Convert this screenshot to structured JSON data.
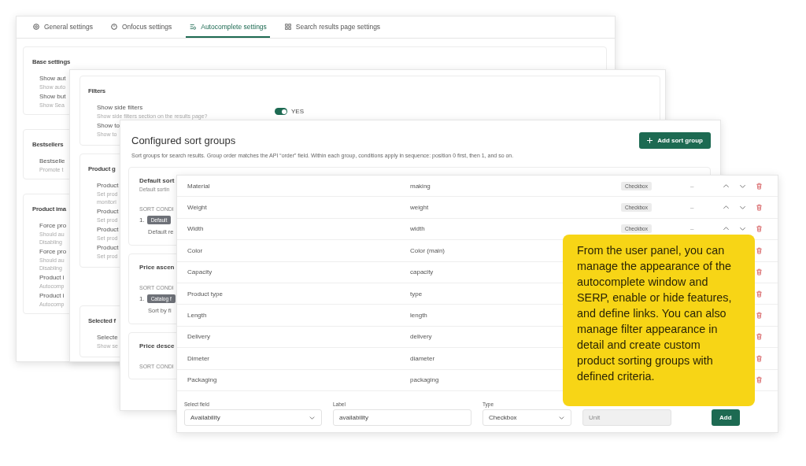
{
  "settings_window": {
    "tabs": [
      {
        "label": "General settings",
        "selected": false
      },
      {
        "label": "Onfocus settings",
        "selected": false
      },
      {
        "label": "Autocomplete settings",
        "selected": true
      },
      {
        "label": "Search results page settings",
        "selected": false
      }
    ],
    "cards": [
      {
        "title": "Base settings",
        "items": [
          {
            "label": "Show aut",
            "hints": [
              "Show auto"
            ]
          },
          {
            "label": "Show but",
            "hints": [
              "Show Sea"
            ]
          }
        ]
      },
      {
        "title": "Bestsellers",
        "items": [
          {
            "label": "Bestselle",
            "hints": [
              "Promote t"
            ]
          }
        ]
      },
      {
        "title": "Product ima",
        "items": [
          {
            "label": "Force pro",
            "hints": [
              "Should au",
              "Disabling"
            ]
          },
          {
            "label": "Force pro",
            "hints": [
              "Should au",
              "Disabling"
            ]
          },
          {
            "label": "Product i",
            "hints": [
              "Autocomp"
            ]
          },
          {
            "label": "Product i",
            "hints": [
              "Autocomp"
            ]
          }
        ]
      }
    ]
  },
  "filters_window": {
    "cards": [
      {
        "title": "Filters",
        "items": [
          {
            "label": "Show side filters",
            "hints": [
              "Show side filters section on the results page?"
            ],
            "toggle": {
              "on": true,
              "label": "YES"
            }
          },
          {
            "label": "Show to",
            "hints": [
              "Show to"
            ]
          }
        ]
      },
      {
        "title": "Product g",
        "items": [
          {
            "label": "Product",
            "hints": [
              "Set prod",
              "monitori"
            ]
          },
          {
            "label": "Product",
            "hints": [
              "Set prod"
            ]
          },
          {
            "label": "Product",
            "hints": [
              "Set prod"
            ]
          },
          {
            "label": "Product",
            "hints": [
              "Set prod"
            ]
          }
        ]
      },
      {
        "title": "Selected f",
        "items": [
          {
            "label": "Selecte",
            "hints": [
              "Show se"
            ]
          }
        ]
      }
    ]
  },
  "sort_window": {
    "title": "Configured sort groups",
    "add_button": "Add sort group",
    "description": "Sort groups for search results. Group order matches the API “order” field. Within each group, conditions apply in sequence: position 0 first, then 1, and so on.",
    "groups": [
      {
        "title": "Default sort",
        "description": "Default sortin",
        "section": "SORT CONDI",
        "conditions": [
          {
            "index": "1.",
            "badge": "Default",
            "text": "Default re"
          }
        ]
      },
      {
        "title": "Price ascen",
        "section": "SORT CONDI",
        "conditions": [
          {
            "index": "1.",
            "badge": "Catalog f",
            "text": "Sort by fi"
          }
        ]
      },
      {
        "title": "Price desce",
        "section": "SORT CONDI"
      }
    ]
  },
  "fields_window": {
    "rows": [
      {
        "name": "Material",
        "label": "making",
        "type": "Checkbox",
        "unit": "–"
      },
      {
        "name": "Weight",
        "label": "weight",
        "type": "Checkbox",
        "unit": "–"
      },
      {
        "name": "Width",
        "label": "width",
        "type": "Checkbox",
        "unit": "–"
      },
      {
        "name": "Color",
        "label": "Color (main)"
      },
      {
        "name": "Capacity",
        "label": "capacity"
      },
      {
        "name": "Product type",
        "label": "type"
      },
      {
        "name": "Length",
        "label": "length"
      },
      {
        "name": "Delivery",
        "label": "delivery"
      },
      {
        "name": "Dimeter",
        "label": "diameter"
      },
      {
        "name": "Packaging",
        "label": "packaging"
      }
    ],
    "form": {
      "select_field": {
        "label": "Select field",
        "value": "Availability"
      },
      "label_field": {
        "label": "Label",
        "value": "availability"
      },
      "type_field": {
        "label": "Type",
        "value": "Checkbox"
      },
      "unit_field": {
        "placeholder": "Unit",
        "disabled": true
      },
      "add_button": "Add"
    }
  },
  "callout": {
    "text": "From the user panel, you can manage the appearance of the autocomplete window and SERP, enable or hide features, and define links. You can also manage filter appearance in detail and create custom product sorting groups with defined criteria."
  }
}
